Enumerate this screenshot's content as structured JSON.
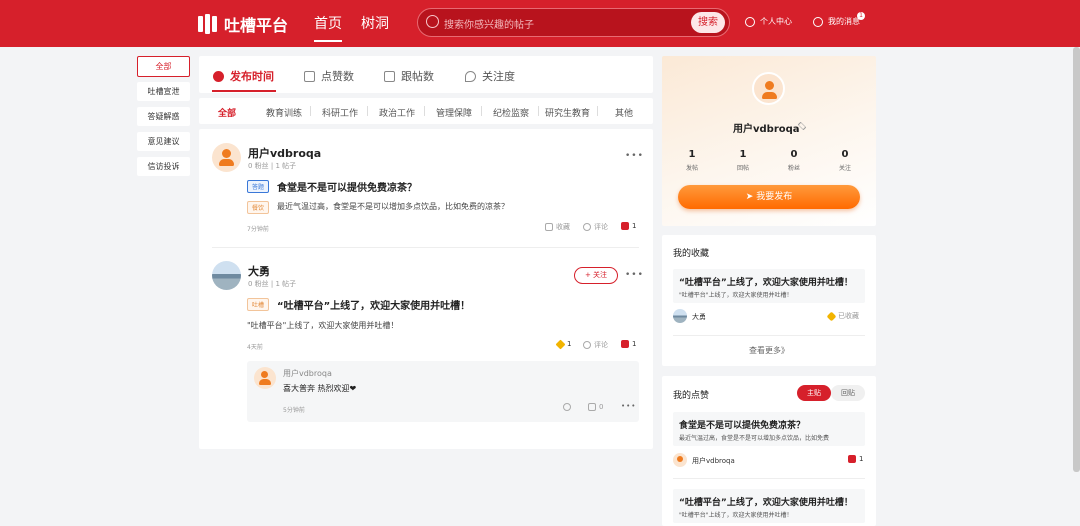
{
  "brand": {
    "name": "吐槽平台",
    "accent": "#d6202b"
  },
  "nav": {
    "home": "首页",
    "treehole": "树洞"
  },
  "search": {
    "placeholder": "搜索你感兴趣的帖子",
    "button": "搜索"
  },
  "user_menu": {
    "center": "个人中心",
    "messages": "我的消息",
    "message_count": "1"
  },
  "sidebar": [
    "全部",
    "吐槽宣泄",
    "答疑解惑",
    "意见建议",
    "信访投诉"
  ],
  "sort_tabs": [
    "发布时间",
    "点赞数",
    "跟帖数",
    "关注度"
  ],
  "categories": [
    "全部",
    "教育训练",
    "科研工作",
    "政治工作",
    "管理保障",
    "纪检监察",
    "研究生教育",
    "其他"
  ],
  "posts": [
    {
      "author": "用户vdbroqa",
      "meta": "0 粉丝 | 1 帖子",
      "tag_title": "答题",
      "title": "食堂是不是可以提供免费凉茶？",
      "tag_body": "餐饮",
      "body": "最近气温过高，食堂是不是可以增加多点饮品，比如免费的凉茶？",
      "time": "7分钟前",
      "collect": "收藏",
      "comment": "评论",
      "likes": "1"
    },
    {
      "author": "大勇",
      "meta": "0 粉丝 | 1 帖子",
      "follow": "+ 关注",
      "tag_title": "吐槽",
      "title": "“吐槽平台”上线了，欢迎大家使用并吐槽！",
      "body": "\"吐槽平台\"上线了，欢迎大家使用并吐槽！",
      "time": "4天前",
      "stars": "1",
      "comment": "评论",
      "likes": "1",
      "reply": {
        "author": "用户vdbroqa",
        "text": "喜大普奔 热烈欢迎❤",
        "time": "5分钟前",
        "likes": "0"
      }
    }
  ],
  "profile": {
    "name": "用户vdbroqa",
    "stats": [
      {
        "n": "1",
        "l": "发帖"
      },
      {
        "n": "1",
        "l": "回帖"
      },
      {
        "n": "0",
        "l": "粉丝"
      },
      {
        "n": "0",
        "l": "关注"
      }
    ],
    "publish": "我要发布"
  },
  "favorites": {
    "title": "我的收藏",
    "item_title": "“吐槽平台”上线了，欢迎大家使用并吐槽！",
    "item_sub": "\"吐槽平台\"上线了，欢迎大家使用并吐槽！",
    "author": "大勇",
    "status": "已收藏",
    "more": "查看更多》"
  },
  "my_likes": {
    "title": "我的点赞",
    "toggle_on": "主贴",
    "toggle_off": "回贴",
    "item1_title": "食堂是不是可以提供免费凉茶？",
    "item1_sub": "最近气温过高，食堂是不是可以增加多点饮品，比如免费",
    "item1_author": "用户vdbroqa",
    "item1_likes": "1",
    "item2_title": "“吐槽平台”上线了，欢迎大家使用并吐槽！",
    "item2_sub": "\"吐槽平台\"上线了，欢迎大家使用并吐槽！"
  }
}
